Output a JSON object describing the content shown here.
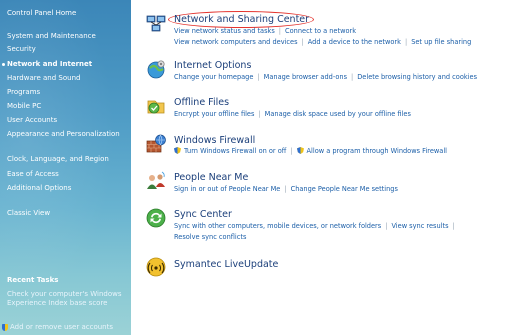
{
  "sidebar": {
    "items": [
      {
        "label": "Control Panel Home"
      },
      {
        "label": "System and Maintenance"
      },
      {
        "label": "Security"
      },
      {
        "label": "Network and Internet",
        "active": true
      },
      {
        "label": "Hardware and Sound"
      },
      {
        "label": "Programs"
      },
      {
        "label": "Mobile PC"
      },
      {
        "label": "User Accounts"
      },
      {
        "label": "Appearance and Personalization"
      },
      {
        "label": "Clock, Language, and Region"
      },
      {
        "label": "Ease of Access"
      },
      {
        "label": "Additional Options"
      },
      {
        "label": "Classic View"
      }
    ],
    "recent_tasks_heading": "Recent Tasks",
    "recent_tasks": [
      {
        "label": "Check your computer's Windows Experience Index base score"
      },
      {
        "label": "Add or remove user accounts"
      }
    ]
  },
  "categories": [
    {
      "title": "Network and Sharing Center",
      "icon": "network-sharing-icon",
      "highlighted": true,
      "task_rows": [
        [
          "View network status and tasks",
          "Connect to a network"
        ],
        [
          "View network computers and devices",
          "Add a device to the network",
          "Set up file sharing"
        ]
      ]
    },
    {
      "title": "Internet Options",
      "icon": "internet-options-icon",
      "task_rows": [
        [
          "Change your homepage",
          "Manage browser add-ons",
          "Delete browsing history and cookies"
        ]
      ]
    },
    {
      "title": "Offline Files",
      "icon": "offline-files-icon",
      "task_rows": [
        [
          "Encrypt your offline files",
          "Manage disk space used by your offline files"
        ]
      ]
    },
    {
      "title": "Windows Firewall",
      "icon": "firewall-icon",
      "task_rows": [
        [
          "Turn Windows Firewall on or off",
          "Allow a program through Windows Firewall"
        ]
      ],
      "task_icons": "uac-shield-icon"
    },
    {
      "title": "People Near Me",
      "icon": "people-near-me-icon",
      "task_rows": [
        [
          "Sign in or out of People Near Me",
          "Change People Near Me settings"
        ]
      ]
    },
    {
      "title": "Sync Center",
      "icon": "sync-center-icon",
      "task_rows": [
        [
          "Sync with other computers, mobile devices, or network folders",
          "View sync results"
        ],
        [
          "Resolve sync conflicts"
        ]
      ]
    },
    {
      "title": "Symantec LiveUpdate",
      "icon": "liveupdate-icon",
      "task_rows": []
    }
  ],
  "colors": {
    "sidebar_top": "#3b86b8",
    "sidebar_bottom": "#9bd2d6",
    "title_text": "#1b3f7a",
    "link_text": "#1c5fa8",
    "highlight": "#e4342e"
  }
}
